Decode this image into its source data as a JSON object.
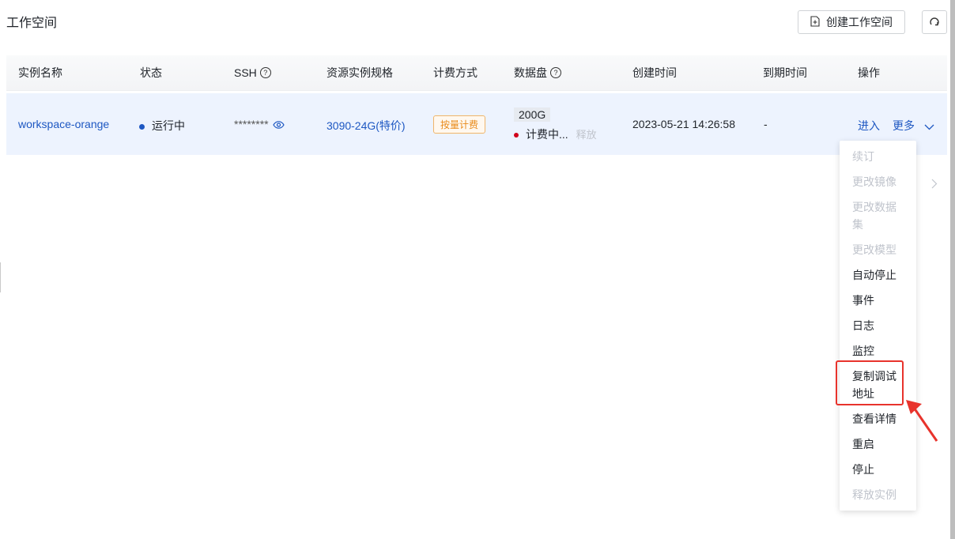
{
  "page": {
    "title": "工作空间"
  },
  "toolbar": {
    "create_label": "创建工作空间",
    "create_icon": "file-plus-icon",
    "refresh_icon": "refresh-icon"
  },
  "table": {
    "headers": {
      "name": "实例名称",
      "status": "状态",
      "ssh": "SSH",
      "spec": "资源实例规格",
      "billing": "计费方式",
      "disk": "数据盘",
      "created": "创建时间",
      "expires": "到期时间",
      "actions": "操作"
    },
    "rows": [
      {
        "name": "workspace-orange",
        "status": "运行中",
        "status_color": "#1d57c2",
        "ssh": "********",
        "spec": "3090-24G(特价)",
        "billing": "按量计费",
        "disk_size": "200G",
        "disk_status": "计费中...",
        "disk_status_color": "#d0021b",
        "disk_release": "释放",
        "created": "2023-05-21 14:26:58",
        "expires": "-",
        "enter": "进入",
        "more": "更多"
      }
    ]
  },
  "more_menu": {
    "items": [
      {
        "label": "续订",
        "disabled": true
      },
      {
        "label": "更改镜像",
        "disabled": true
      },
      {
        "label": "更改数据集",
        "disabled": true
      },
      {
        "label": "更改模型",
        "disabled": true
      },
      {
        "label": "自动停止",
        "disabled": false
      },
      {
        "label": "事件",
        "disabled": false
      },
      {
        "label": "日志",
        "disabled": false
      },
      {
        "label": "监控",
        "disabled": false
      },
      {
        "label": "复制调试地址",
        "disabled": false,
        "highlighted": true
      },
      {
        "label": "查看详情",
        "disabled": false
      },
      {
        "label": "重启",
        "disabled": false
      },
      {
        "label": "停止",
        "disabled": false
      },
      {
        "label": "释放实例",
        "disabled": true
      }
    ]
  },
  "colors": {
    "accent": "#1d57c2",
    "annotation": "#e8332c"
  }
}
